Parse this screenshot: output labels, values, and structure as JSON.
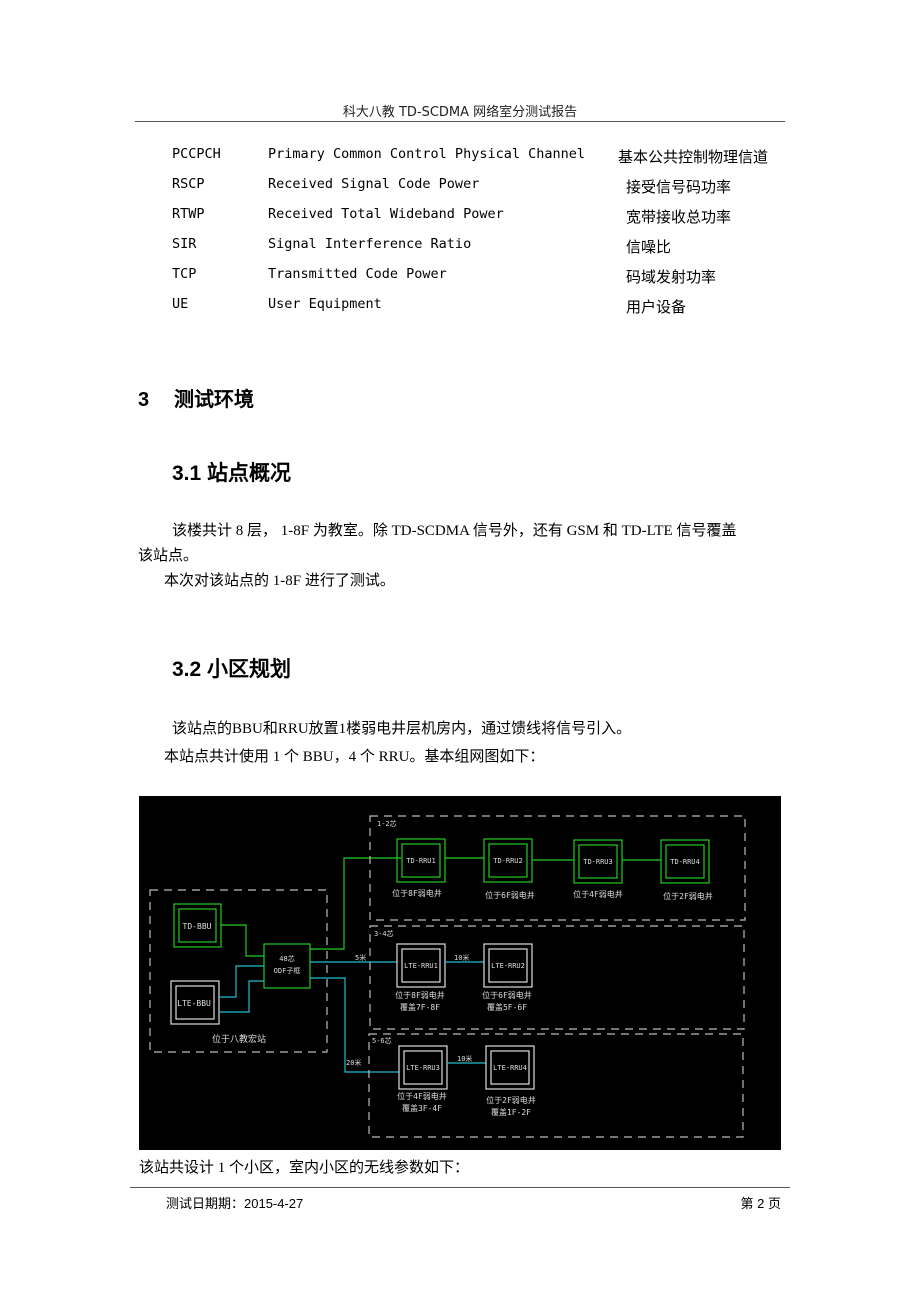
{
  "header": {
    "title": "科大八教 TD-SCDMA 网络室分测试报告"
  },
  "abbreviations": [
    {
      "code": "PCCPCH",
      "full": "Primary Common Control Physical Channel",
      "zh": "基本公共控制物理信道"
    },
    {
      "code": "RSCP",
      "full": "Received Signal Code Power",
      "zh": "接受信号码功率"
    },
    {
      "code": "RTWP",
      "full": "Received Total Wideband Power",
      "zh": "宽带接收总功率"
    },
    {
      "code": "SIR",
      "full": "Signal Interference Ratio",
      "zh": "信噪比"
    },
    {
      "code": "TCP",
      "full": "Transmitted Code Power",
      "zh": "码域发射功率"
    },
    {
      "code": "UE",
      "full": "User Equipment",
      "zh": "用户设备"
    }
  ],
  "section3": {
    "number": "3",
    "title": "测试环境"
  },
  "section31": {
    "title": "3.1 站点概况",
    "para1_line1": "该楼共计 8 层， 1-8F 为教室。除 TD-SCDMA 信号外，还有 GSM 和 TD-LTE 信号覆盖",
    "para1_line2": "该站点。",
    "para2": "本次对该站点的 1-8F 进行了测试。"
  },
  "section32": {
    "title": "3.2 小区规划",
    "para1": "该站点的BBU和RRU放置1楼弱电井层机房内，通过馈线将信号引入。",
    "para2": "本站点共计使用 1 个 BBU，4 个 RRU。基本组网图如下："
  },
  "diagram": {
    "colors": {
      "td": "#22cc22",
      "lte": "#dddddd",
      "fiber_lte": "#22bbcc",
      "dashed": "#bbbbbb",
      "background": "#000000"
    },
    "site_label": "位于八教宏站",
    "td_bbu": "TD-BBU",
    "lte_bbu": "LTE-BBU",
    "odf_line1": "48芯",
    "odf_line2": "ODF子框",
    "group_12": "1-2芯",
    "group_34": "3-4芯",
    "group_56": "5-6芯",
    "td_rrus": [
      {
        "name": "TD-RRU1",
        "loc": "位于8F弱电井"
      },
      {
        "name": "TD-RRU2",
        "loc": "位于6F弱电井"
      },
      {
        "name": "TD-RRU3",
        "loc": "位于4F弱电井"
      },
      {
        "name": "TD-RRU4",
        "loc": "位于2F弱电井"
      }
    ],
    "lte_rrus": [
      {
        "name": "LTE-RRU1",
        "loc": "位于8F弱电井",
        "cover": "覆盖7F-8F"
      },
      {
        "name": "LTE-RRU2",
        "loc": "位于6F弱电井",
        "cover": "覆盖5F-6F"
      },
      {
        "name": "LTE-RRU3",
        "loc": "位于4F弱电井",
        "cover": "覆盖3F-4F"
      },
      {
        "name": "LTE-RRU4",
        "loc": "位于2F弱电井",
        "cover": "覆盖1F-2F"
      }
    ],
    "dist_5m": "5米",
    "dist_10m_a": "10米",
    "dist_20m": "20米",
    "dist_10m_b": "10米"
  },
  "after_diagram": "该站共设计 1 个小区，室内小区的无线参数如下：",
  "footer": {
    "date": "测试日期期：2015-4-27",
    "page": "第 2 页"
  }
}
